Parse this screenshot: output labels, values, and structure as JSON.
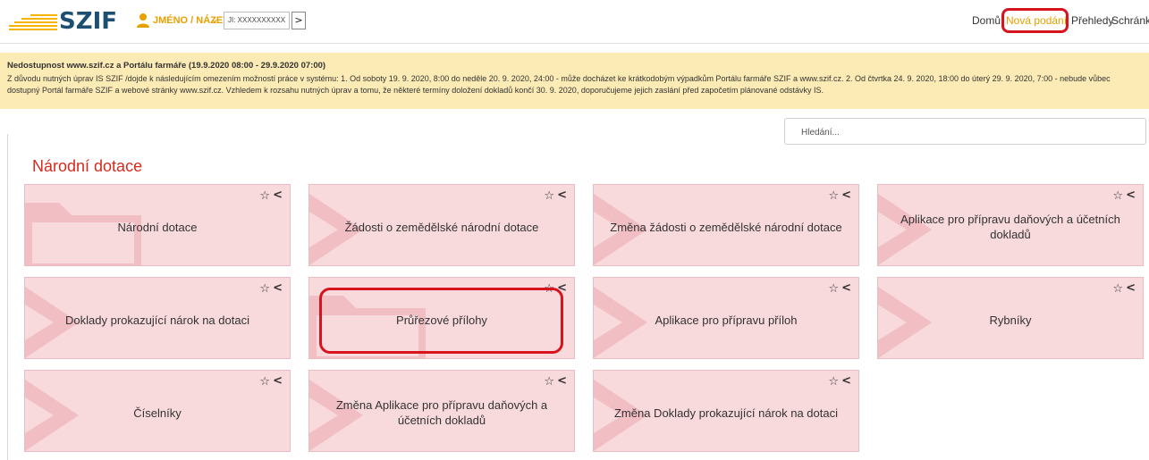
{
  "header": {
    "logo_text": "SZIF",
    "user_name": "JMÉNO / NÁZEV",
    "ji_value": "JI: XXXXXXXXXX",
    "go_label": ">",
    "nav": [
      {
        "label": "Domů",
        "active": false
      },
      {
        "label": "Nová podání",
        "active": true
      },
      {
        "label": "Přehledy",
        "active": false
      },
      {
        "label": "Schránka",
        "active": false
      }
    ]
  },
  "notice": {
    "title": "Nedostupnost www.szif.cz a Portálu farmáře (19.9.2020 08:00 - 29.9.2020 07:00)",
    "body": "Z důvodu nutných úprav IS SZIF /dojde k následujícím omezením možností práce v systému: 1. Od soboty 19. 9. 2020, 8:00 do neděle 20. 9. 2020, 24:00 - může docházet ke krátkodobým výpadkům Portálu farmáře SZIF a www.szif.cz. 2. Od čtvrtka 24. 9. 2020, 18:00 do úterý 29. 9. 2020, 7:00 - nebude vůbec dostupný Portál farmáře SZIF a webové stránky www.szif.cz. Vzhledem k rozsahu nutných úprav a tomu, že některé termíny doložení dokladů končí 30. 9. 2020, doporučujeme jejich zaslání před započetím plánované odstávky IS."
  },
  "search": {
    "placeholder": "Hledání..."
  },
  "section_title": "Národní dotace",
  "tiles": [
    {
      "label": "Národní dotace",
      "icon": "folder"
    },
    {
      "label": "Žádosti o zemědělské národní dotace",
      "icon": "chevron"
    },
    {
      "label": "Změna žádosti o zemědělské národní dotace",
      "icon": "chevron"
    },
    {
      "label": "Aplikace pro přípravu daňových a účetních dokladů",
      "icon": "chevron"
    },
    {
      "label": "Doklady prokazující nárok na dotaci",
      "icon": "chevron"
    },
    {
      "label": "Průřezové přílohy",
      "icon": "folder"
    },
    {
      "label": "Aplikace pro přípravu příloh",
      "icon": "chevron"
    },
    {
      "label": "Rybníky",
      "icon": "chevron"
    },
    {
      "label": "Číselníky",
      "icon": "chevron"
    },
    {
      "label": "Změna Aplikace pro přípravu daňových a účetních dokladů",
      "icon": "chevron"
    },
    {
      "label": "Změna Doklady prokazující nárok na dotaci",
      "icon": "chevron"
    }
  ],
  "tile_actions": {
    "star": "☆",
    "collapse": "<"
  },
  "colors": {
    "brand_blue": "#1d4f73",
    "accent": "#e8a000",
    "tile_bg": "#f8d9dc",
    "highlight": "#d7141e",
    "notice_bg": "#fcebb5"
  }
}
